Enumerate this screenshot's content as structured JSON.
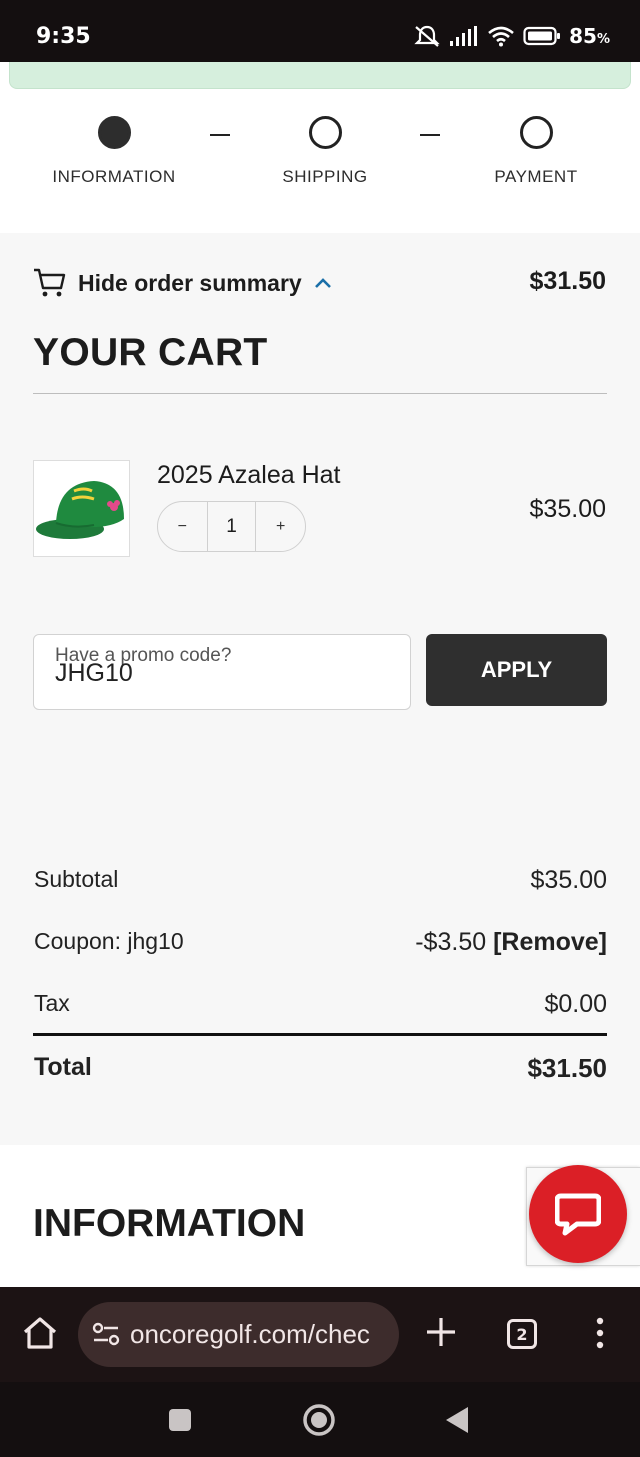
{
  "status_bar": {
    "time": "9:35",
    "battery_percent": "85",
    "battery_unit": "%"
  },
  "steps": [
    {
      "label": "INFORMATION",
      "state": "active"
    },
    {
      "label": "SHIPPING",
      "state": "inactive"
    },
    {
      "label": "PAYMENT",
      "state": "inactive"
    }
  ],
  "summary": {
    "toggle_label": "Hide order summary",
    "total": "$31.50",
    "cart_title": "YOUR CART"
  },
  "cart_item": {
    "name": "2025 Azalea Hat",
    "quantity": "1",
    "decrement": "−",
    "increment": "+",
    "price": "$35.00"
  },
  "promo": {
    "placeholder": "Have a promo code?",
    "value": "JHG10",
    "apply_label": "APPLY"
  },
  "totals": {
    "subtotal_label": "Subtotal",
    "subtotal": "$35.00",
    "coupon_label": "Coupon: jhg10",
    "coupon_amount": "-$3.50",
    "remove_label": "[Remove]",
    "tax_label": "Tax",
    "tax": "$0.00",
    "total_label": "Total",
    "total": "$31.50"
  },
  "information": {
    "title": "INFORMATION"
  },
  "browser": {
    "url": "oncoregolf.com/chec",
    "tab_count": "2"
  },
  "colors": {
    "accent_chevron": "#1a6fa8",
    "chat_button": "#db1f26",
    "apply_button": "#2f2f2f",
    "notice_banner": "#d6efdd"
  },
  "icons": {
    "cart": "cart-icon",
    "chevron": "chevron-up-icon",
    "chat": "chat-bubble-icon"
  }
}
